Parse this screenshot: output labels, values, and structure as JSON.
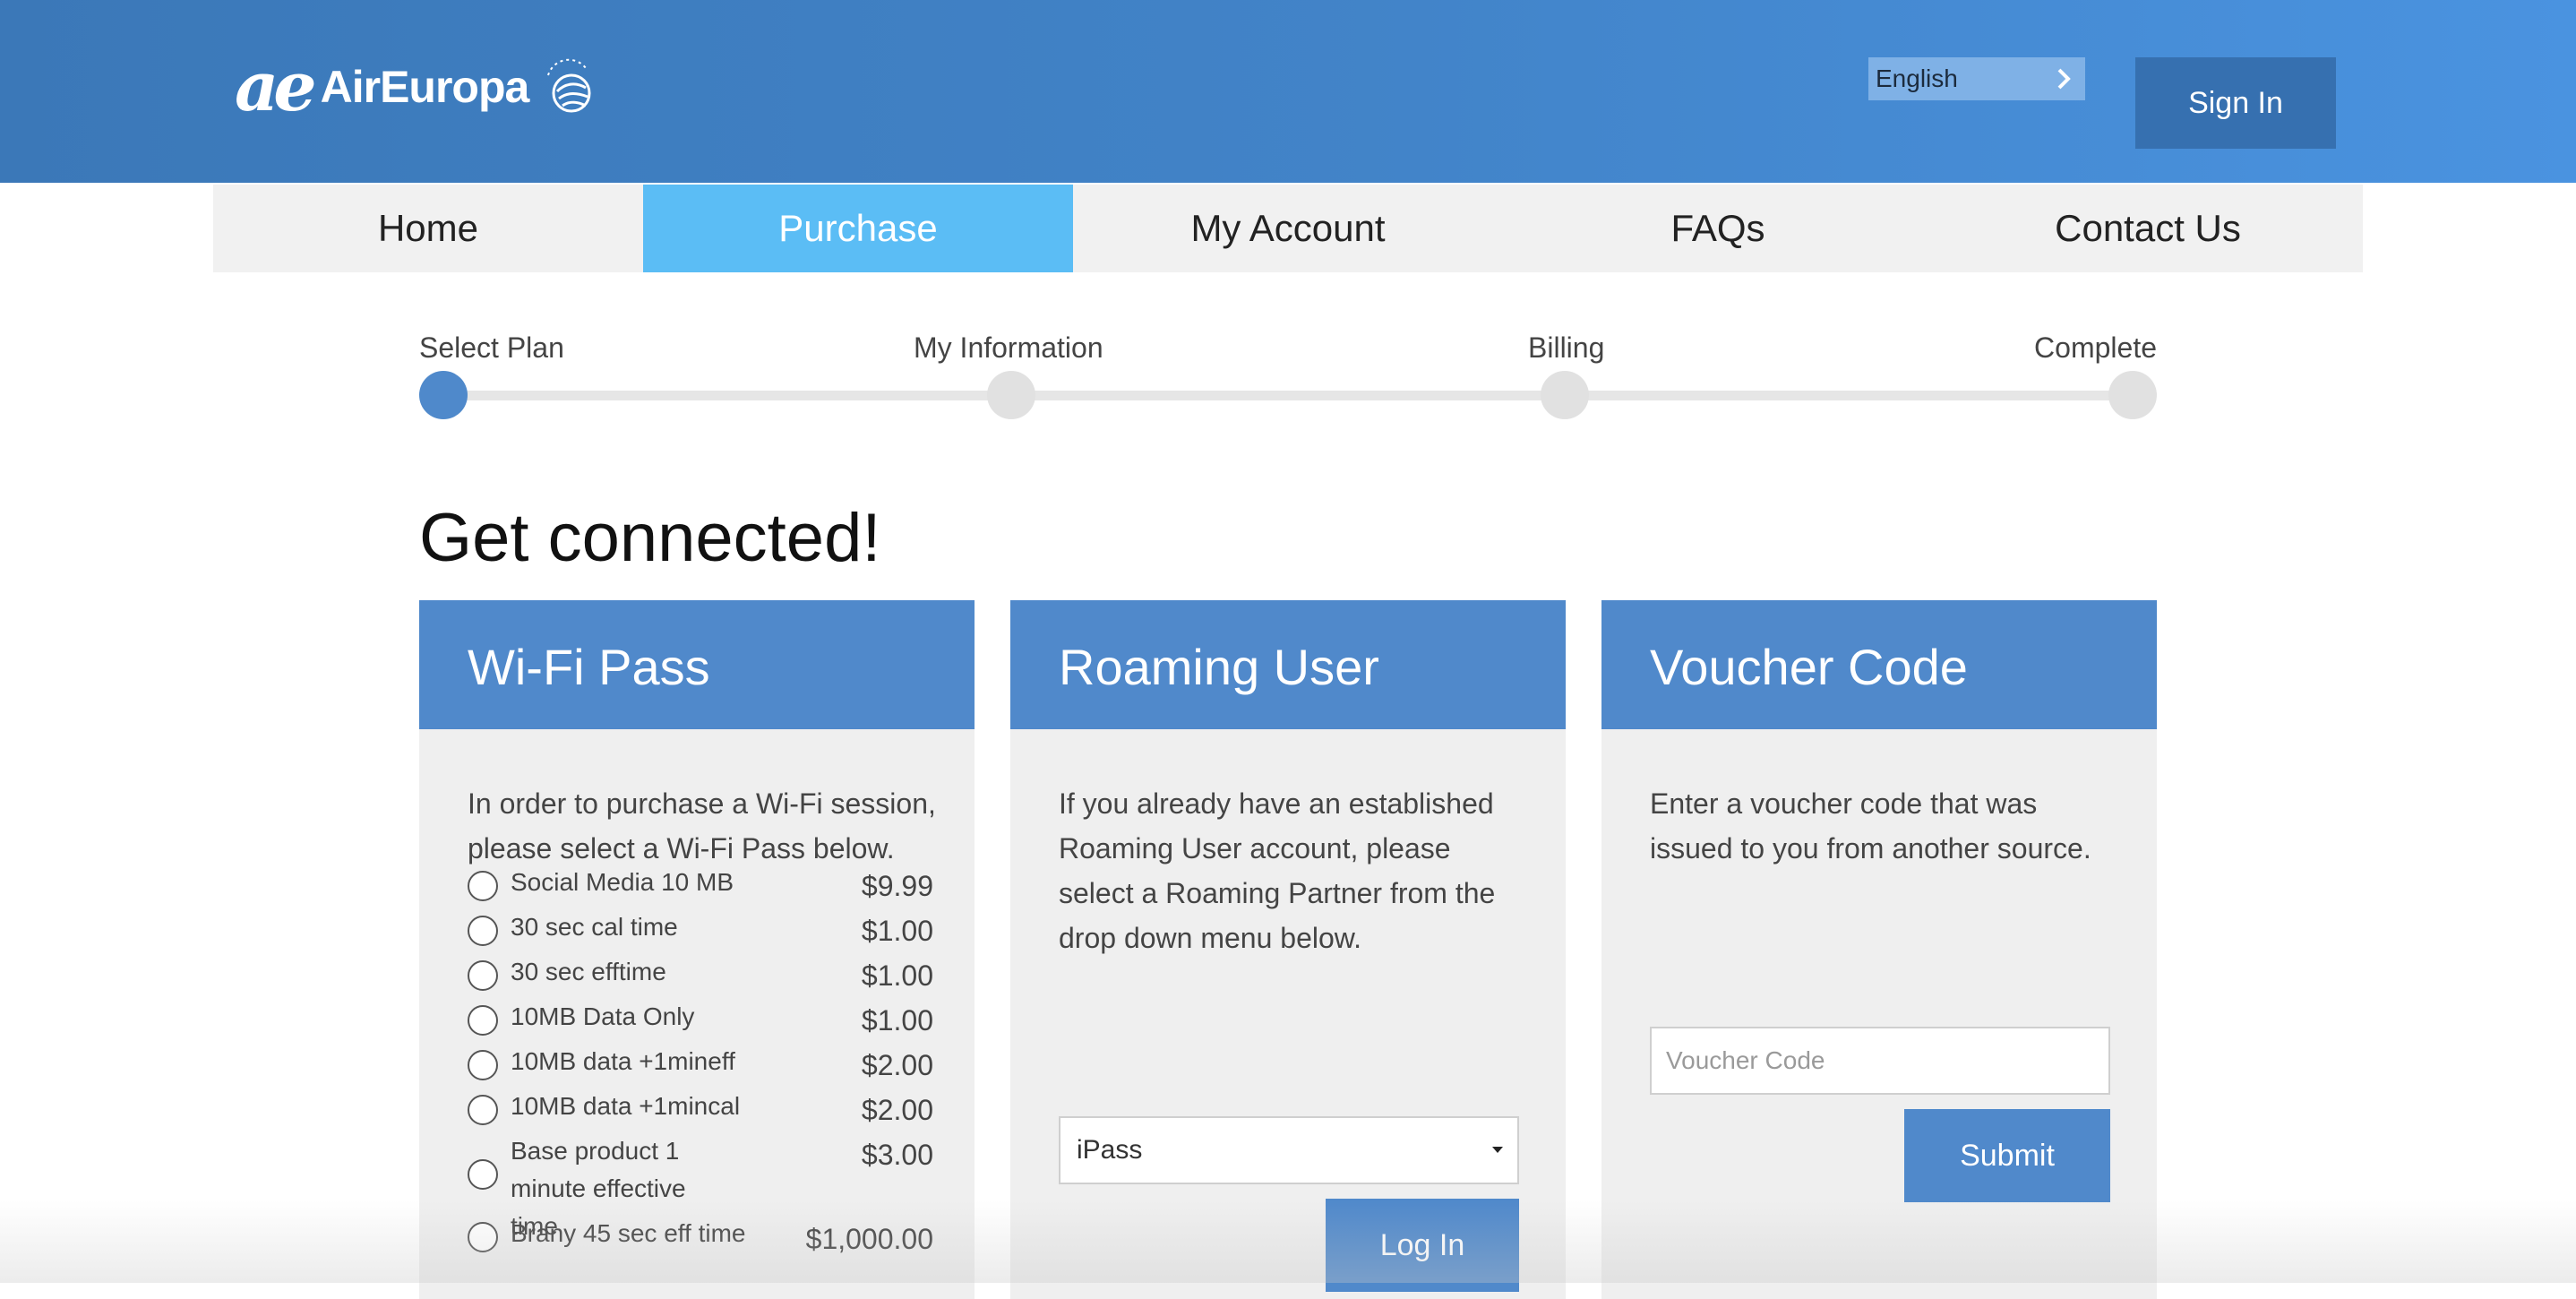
{
  "brand": {
    "logo_mark": "ae",
    "logo_word": "AirEuropa",
    "alliance": "SKYTEAM"
  },
  "header": {
    "language": "English",
    "signin_label": "Sign In"
  },
  "nav": {
    "items": [
      {
        "label": "Home"
      },
      {
        "label": "Purchase"
      },
      {
        "label": "My Account"
      },
      {
        "label": "FAQs"
      },
      {
        "label": "Contact Us"
      }
    ],
    "active_index": 1
  },
  "steps": [
    {
      "label": "Select Plan",
      "active": true
    },
    {
      "label": "My Information",
      "active": false
    },
    {
      "label": "Billing",
      "active": false
    },
    {
      "label": "Complete",
      "active": false
    }
  ],
  "page_title": "Get connected!",
  "wifi": {
    "title": "Wi-Fi Pass",
    "text": "In order to purchase a Wi-Fi session, please select a Wi-Fi Pass below.",
    "plans": [
      {
        "name": "Social Media 10 MB",
        "price": "$9.99"
      },
      {
        "name": "30 sec cal time",
        "price": "$1.00"
      },
      {
        "name": "30 sec efftime",
        "price": "$1.00"
      },
      {
        "name": "10MB Data Only",
        "price": "$1.00"
      },
      {
        "name": "10MB data +1mineff",
        "price": "$2.00"
      },
      {
        "name": "10MB data +1mincal",
        "price": "$2.00"
      },
      {
        "name": "Base product 1 minute effective time",
        "price": "$3.00"
      },
      {
        "name": "Brany 45 sec eff time",
        "price": "$1,000.00"
      }
    ]
  },
  "roaming": {
    "title": "Roaming User",
    "text": "If you already have an established Roaming User account, please select a Roaming Partner from the drop down menu below.",
    "partner": "iPass",
    "login_label": "Log In"
  },
  "voucher": {
    "title": "Voucher Code",
    "text": "Enter a voucher code that was issued to you from another source.",
    "placeholder": "Voucher Code",
    "submit_label": "Submit"
  },
  "colors": {
    "header_blue": "#4284c9",
    "card_blue": "#5089cb",
    "nav_active": "#5bbdf5"
  }
}
